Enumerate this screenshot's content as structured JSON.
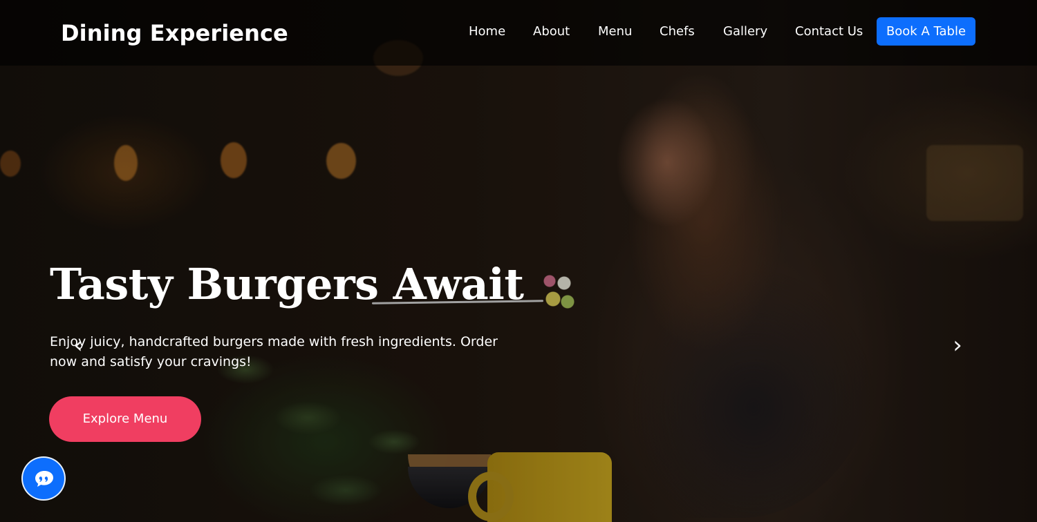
{
  "brand": {
    "title": "Dining Experience"
  },
  "nav": {
    "items": [
      "Home",
      "About",
      "Menu",
      "Chefs",
      "Gallery",
      "Contact Us"
    ],
    "cta_label": "Book A Table"
  },
  "hero": {
    "title": "Tasty Burgers Await",
    "description": "Enjoy juicy, handcrafted burgers made with fresh ingredients. Order now and satisfy your cravings!",
    "button_label": "Explore Menu",
    "prev_icon": "chevron-left-icon",
    "next_icon": "chevron-right-icon"
  },
  "chat": {
    "icon": "chat-bubble-icon"
  },
  "colors": {
    "primary": "#0d6efd",
    "accent": "#f03e61",
    "text": "#ffffff",
    "nav_background": "#000000"
  }
}
